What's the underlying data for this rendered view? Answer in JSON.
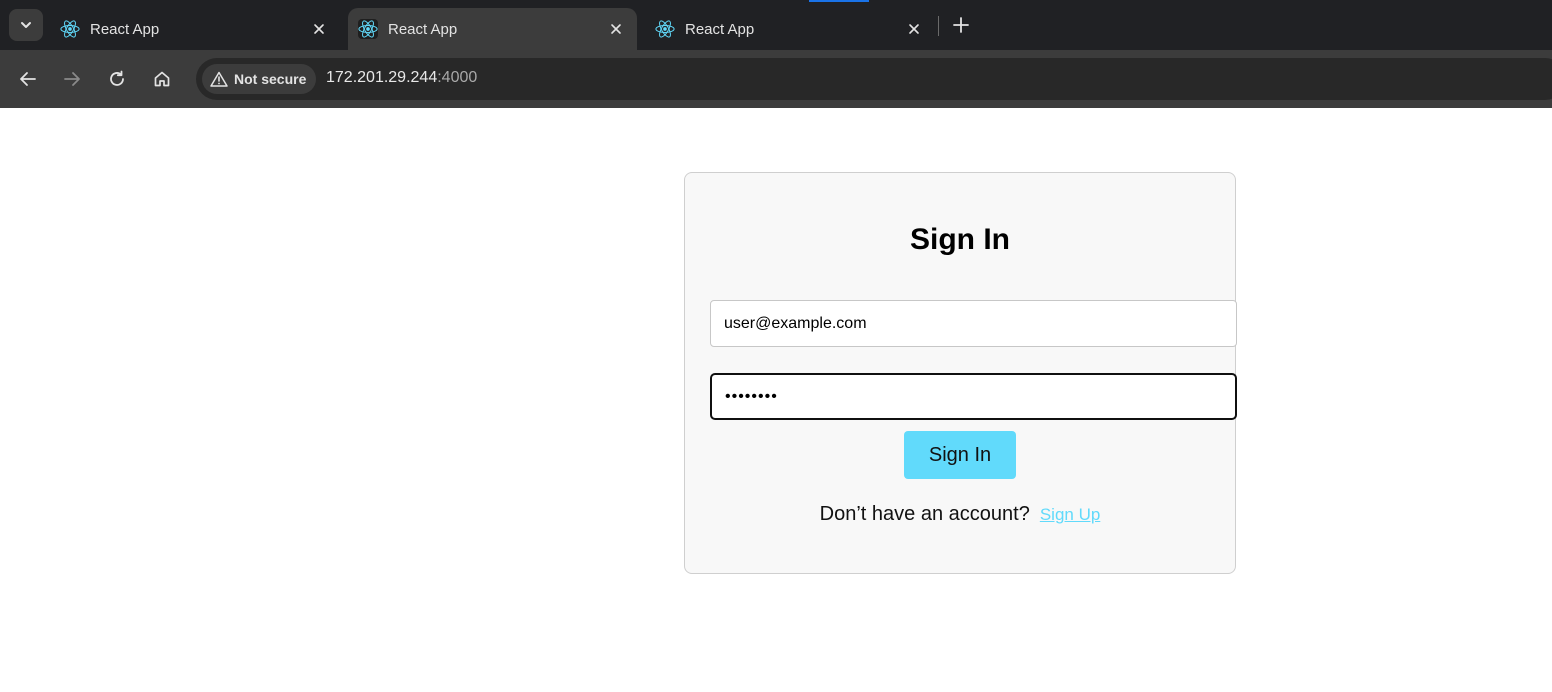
{
  "browser": {
    "tabs": [
      {
        "title": "React App",
        "active": false
      },
      {
        "title": "React App",
        "active": true
      },
      {
        "title": "React App",
        "active": false
      }
    ],
    "security_label": "Not secure",
    "url_host": "172.201.29.244",
    "url_port": ":4000",
    "icons": {
      "favicon": "react-icon",
      "tab_close": "close-icon",
      "new_tab": "plus-icon",
      "tab_search": "chevron-down-icon",
      "back": "back-arrow-icon",
      "forward": "forward-arrow-icon",
      "reload": "reload-icon",
      "home": "home-icon",
      "security": "warning-icon"
    },
    "colors": {
      "tabstrip": "#202124",
      "toolbar": "#3c3c3c",
      "omnibox": "#282828"
    }
  },
  "signin": {
    "title": "Sign In",
    "email_value": "user@example.com",
    "password_value": "password",
    "button_label": "Sign In",
    "prompt_text": "Don’t have an account?",
    "signup_link": "Sign Up",
    "colors": {
      "accent": "#61dafb",
      "card_bg": "#f8f8f8"
    }
  }
}
